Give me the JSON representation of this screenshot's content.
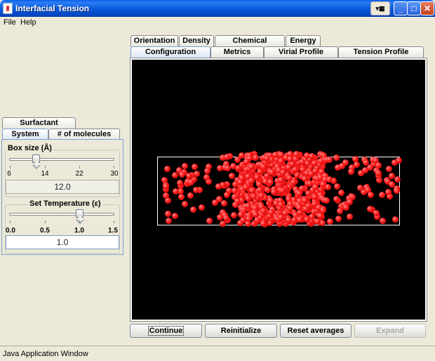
{
  "window": {
    "title": "Interfacial Tension"
  },
  "menu": {
    "items": [
      "File",
      "Help"
    ]
  },
  "tabs": {
    "row1": [
      "Orientation",
      "Density",
      "Chemical Potential",
      "Energy"
    ],
    "row2": [
      "Configuration",
      "Metrics",
      "Virial Profile",
      "Tension Profile"
    ],
    "active": "Configuration"
  },
  "buttons": {
    "continue": "Continue",
    "reinitialize": "Reinitialize",
    "reset": "Reset averages",
    "expand": "Expand"
  },
  "left_tabs": {
    "row1": [
      "Surfactant potential"
    ],
    "row2": [
      "System",
      "# of molecules"
    ],
    "active": "System"
  },
  "box_size": {
    "title": "Box size (Å)",
    "ticks": [
      "6",
      "14",
      "22",
      "30"
    ],
    "value": "12.0",
    "slider_min": 6,
    "slider_max": 30,
    "slider_value": 12
  },
  "temperature": {
    "title": "Set Temperature (ε)",
    "ticks": [
      "0.0",
      "0.5",
      "1.0",
      "1.5"
    ],
    "value": "1.0",
    "slider_min": 0,
    "slider_max": 1.5,
    "slider_value": 1.0
  },
  "colors": {
    "molecule": "#ff1c1c",
    "background": "#000000",
    "box": "#ffffff"
  },
  "status": {
    "text": "Java Application Window"
  }
}
